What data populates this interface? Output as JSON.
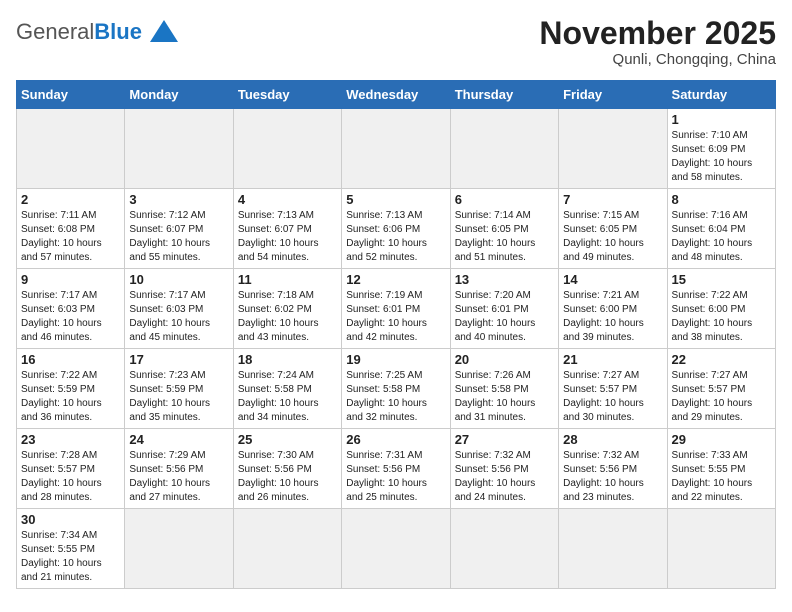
{
  "header": {
    "logo_general": "General",
    "logo_blue": "Blue",
    "month_title": "November 2025",
    "location": "Qunli, Chongqing, China"
  },
  "weekdays": [
    "Sunday",
    "Monday",
    "Tuesday",
    "Wednesday",
    "Thursday",
    "Friday",
    "Saturday"
  ],
  "weeks": [
    [
      {
        "day": "",
        "info": ""
      },
      {
        "day": "",
        "info": ""
      },
      {
        "day": "",
        "info": ""
      },
      {
        "day": "",
        "info": ""
      },
      {
        "day": "",
        "info": ""
      },
      {
        "day": "",
        "info": ""
      },
      {
        "day": "1",
        "info": "Sunrise: 7:10 AM\nSunset: 6:09 PM\nDaylight: 10 hours and 58 minutes."
      }
    ],
    [
      {
        "day": "2",
        "info": "Sunrise: 7:11 AM\nSunset: 6:08 PM\nDaylight: 10 hours and 57 minutes."
      },
      {
        "day": "3",
        "info": "Sunrise: 7:12 AM\nSunset: 6:07 PM\nDaylight: 10 hours and 55 minutes."
      },
      {
        "day": "4",
        "info": "Sunrise: 7:13 AM\nSunset: 6:07 PM\nDaylight: 10 hours and 54 minutes."
      },
      {
        "day": "5",
        "info": "Sunrise: 7:13 AM\nSunset: 6:06 PM\nDaylight: 10 hours and 52 minutes."
      },
      {
        "day": "6",
        "info": "Sunrise: 7:14 AM\nSunset: 6:05 PM\nDaylight: 10 hours and 51 minutes."
      },
      {
        "day": "7",
        "info": "Sunrise: 7:15 AM\nSunset: 6:05 PM\nDaylight: 10 hours and 49 minutes."
      },
      {
        "day": "8",
        "info": "Sunrise: 7:16 AM\nSunset: 6:04 PM\nDaylight: 10 hours and 48 minutes."
      }
    ],
    [
      {
        "day": "9",
        "info": "Sunrise: 7:17 AM\nSunset: 6:03 PM\nDaylight: 10 hours and 46 minutes."
      },
      {
        "day": "10",
        "info": "Sunrise: 7:17 AM\nSunset: 6:03 PM\nDaylight: 10 hours and 45 minutes."
      },
      {
        "day": "11",
        "info": "Sunrise: 7:18 AM\nSunset: 6:02 PM\nDaylight: 10 hours and 43 minutes."
      },
      {
        "day": "12",
        "info": "Sunrise: 7:19 AM\nSunset: 6:01 PM\nDaylight: 10 hours and 42 minutes."
      },
      {
        "day": "13",
        "info": "Sunrise: 7:20 AM\nSunset: 6:01 PM\nDaylight: 10 hours and 40 minutes."
      },
      {
        "day": "14",
        "info": "Sunrise: 7:21 AM\nSunset: 6:00 PM\nDaylight: 10 hours and 39 minutes."
      },
      {
        "day": "15",
        "info": "Sunrise: 7:22 AM\nSunset: 6:00 PM\nDaylight: 10 hours and 38 minutes."
      }
    ],
    [
      {
        "day": "16",
        "info": "Sunrise: 7:22 AM\nSunset: 5:59 PM\nDaylight: 10 hours and 36 minutes."
      },
      {
        "day": "17",
        "info": "Sunrise: 7:23 AM\nSunset: 5:59 PM\nDaylight: 10 hours and 35 minutes."
      },
      {
        "day": "18",
        "info": "Sunrise: 7:24 AM\nSunset: 5:58 PM\nDaylight: 10 hours and 34 minutes."
      },
      {
        "day": "19",
        "info": "Sunrise: 7:25 AM\nSunset: 5:58 PM\nDaylight: 10 hours and 32 minutes."
      },
      {
        "day": "20",
        "info": "Sunrise: 7:26 AM\nSunset: 5:58 PM\nDaylight: 10 hours and 31 minutes."
      },
      {
        "day": "21",
        "info": "Sunrise: 7:27 AM\nSunset: 5:57 PM\nDaylight: 10 hours and 30 minutes."
      },
      {
        "day": "22",
        "info": "Sunrise: 7:27 AM\nSunset: 5:57 PM\nDaylight: 10 hours and 29 minutes."
      }
    ],
    [
      {
        "day": "23",
        "info": "Sunrise: 7:28 AM\nSunset: 5:57 PM\nDaylight: 10 hours and 28 minutes."
      },
      {
        "day": "24",
        "info": "Sunrise: 7:29 AM\nSunset: 5:56 PM\nDaylight: 10 hours and 27 minutes."
      },
      {
        "day": "25",
        "info": "Sunrise: 7:30 AM\nSunset: 5:56 PM\nDaylight: 10 hours and 26 minutes."
      },
      {
        "day": "26",
        "info": "Sunrise: 7:31 AM\nSunset: 5:56 PM\nDaylight: 10 hours and 25 minutes."
      },
      {
        "day": "27",
        "info": "Sunrise: 7:32 AM\nSunset: 5:56 PM\nDaylight: 10 hours and 24 minutes."
      },
      {
        "day": "28",
        "info": "Sunrise: 7:32 AM\nSunset: 5:56 PM\nDaylight: 10 hours and 23 minutes."
      },
      {
        "day": "29",
        "info": "Sunrise: 7:33 AM\nSunset: 5:55 PM\nDaylight: 10 hours and 22 minutes."
      }
    ],
    [
      {
        "day": "30",
        "info": "Sunrise: 7:34 AM\nSunset: 5:55 PM\nDaylight: 10 hours and 21 minutes."
      },
      {
        "day": "",
        "info": ""
      },
      {
        "day": "",
        "info": ""
      },
      {
        "day": "",
        "info": ""
      },
      {
        "day": "",
        "info": ""
      },
      {
        "day": "",
        "info": ""
      },
      {
        "day": "",
        "info": ""
      }
    ]
  ]
}
